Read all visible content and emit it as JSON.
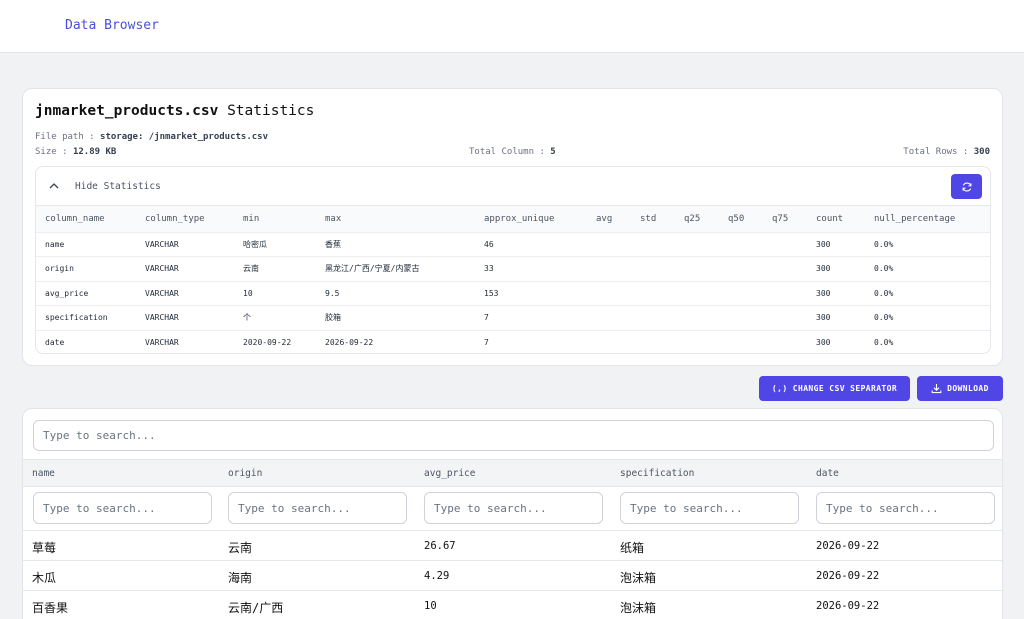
{
  "header": {
    "brand": "Data Browser"
  },
  "stats": {
    "file_name": "jnmarket_products.csv",
    "title_suffix": "Statistics",
    "file_path_label": "File path :",
    "file_path_value": "storage: /jnmarket_products.csv",
    "size_label": "Size :",
    "size_value": "12.89 KB",
    "total_column_label": "Total Column :",
    "total_column_value": "5",
    "total_rows_label": "Total Rows :",
    "total_rows_value": "300",
    "toggle_label": "Hide Statistics",
    "columns": [
      "column_name",
      "column_type",
      "min",
      "max",
      "approx_unique",
      "avg",
      "std",
      "q25",
      "q50",
      "q75",
      "count",
      "null_percentage"
    ],
    "rows": [
      [
        "name",
        "VARCHAR",
        "哈密瓜",
        "香蕉",
        "46",
        "",
        "",
        "",
        "",
        "",
        "300",
        "0.0%"
      ],
      [
        "origin",
        "VARCHAR",
        "云南",
        "黑龙江/广西/宁夏/内蒙古",
        "33",
        "",
        "",
        "",
        "",
        "",
        "300",
        "0.0%"
      ],
      [
        "avg_price",
        "VARCHAR",
        "10",
        "9.5",
        "153",
        "",
        "",
        "",
        "",
        "",
        "300",
        "0.0%"
      ],
      [
        "specification",
        "VARCHAR",
        "个",
        "胶箱",
        "7",
        "",
        "",
        "",
        "",
        "",
        "300",
        "0.0%"
      ],
      [
        "date",
        "VARCHAR",
        "2020-09-22",
        "2026-09-22",
        "7",
        "",
        "",
        "",
        "",
        "",
        "300",
        "0.0%"
      ]
    ]
  },
  "actions": {
    "change_separator": "(,) CHANGE CSV SEPARATOR",
    "download": "DOWNLOAD"
  },
  "data_table": {
    "search_placeholder": "Type to search...",
    "columns": [
      "name",
      "origin",
      "avg_price",
      "specification",
      "date"
    ],
    "column_search_placeholder": "Type to search...",
    "rows": [
      [
        "草莓",
        "云南",
        "26.67",
        "纸箱",
        "2026-09-22"
      ],
      [
        "木瓜",
        "海南",
        "4.29",
        "泡沫箱",
        "2026-09-22"
      ],
      [
        "百香果",
        "云南/广西",
        "10",
        "泡沫箱",
        "2026-09-22"
      ]
    ]
  },
  "colors": {
    "accent": "#4f46e5",
    "brand_text": "#4b4fd6",
    "page_bg": "#f1f2f4"
  }
}
